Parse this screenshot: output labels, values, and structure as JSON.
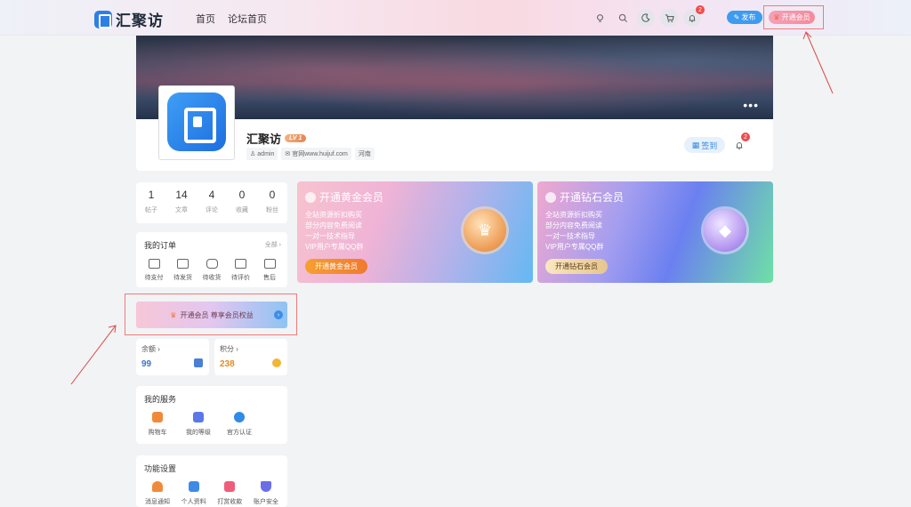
{
  "header": {
    "logo_text": "汇聚访",
    "nav": [
      "首页",
      "论坛首页"
    ],
    "notif_count": "2",
    "publish_label": "发布",
    "vip_label": "开通会员"
  },
  "profile": {
    "name": "汇聚访",
    "level": "LV 1",
    "chips": [
      "admin",
      "官网www.huijuf.com",
      "河南"
    ],
    "checkin_label": "签到",
    "notif_count": "2"
  },
  "stats": [
    {
      "value": "1",
      "label": "帖子"
    },
    {
      "value": "14",
      "label": "文章"
    },
    {
      "value": "4",
      "label": "评论"
    },
    {
      "value": "0",
      "label": "收藏"
    },
    {
      "value": "0",
      "label": "粉丝"
    }
  ],
  "orders": {
    "title": "我的订单",
    "all": "全部",
    "items": [
      "待支付",
      "待发货",
      "待收货",
      "待评价",
      "售后"
    ]
  },
  "vip_bar": {
    "label": "开通会员 尊享会员权益"
  },
  "balance": {
    "title": "余额",
    "value": "99",
    "color": "#3a74c8"
  },
  "points": {
    "title": "积分",
    "value": "238",
    "color": "#e58a1f"
  },
  "services": {
    "title": "我的服务",
    "items": [
      {
        "label": "购物车",
        "icon": "cart-icon",
        "color": "#f08a3a"
      },
      {
        "label": "我的等级",
        "icon": "chart-icon",
        "color": "#5a78e8"
      },
      {
        "label": "官方认证",
        "icon": "verified-icon",
        "color": "#2f8be6"
      }
    ]
  },
  "settings": {
    "title": "功能设置",
    "items": [
      {
        "label": "消息通知",
        "icon": "bell-icon",
        "color": "#f08a3a"
      },
      {
        "label": "个人资料",
        "icon": "profile-icon",
        "color": "#3d8be6"
      },
      {
        "label": "打赏收款",
        "icon": "gift-icon",
        "color": "#ef5d7a"
      },
      {
        "label": "账户安全",
        "icon": "shield-icon",
        "color": "#6a6ee8"
      }
    ]
  },
  "gold_card": {
    "title": "开通黄金会员",
    "lines": [
      "全站资源折扣购买",
      "部分内容免费阅读",
      "一对一技术指导",
      "VIP用户专属QQ群"
    ],
    "button": "开通黄金会员"
  },
  "diamond_card": {
    "title": "开通钻石会员",
    "lines": [
      "全站资源折扣购买",
      "部分内容免费阅读",
      "一对一技术指导",
      "VIP用户专属QQ群"
    ],
    "button": "开通钻石会员"
  }
}
